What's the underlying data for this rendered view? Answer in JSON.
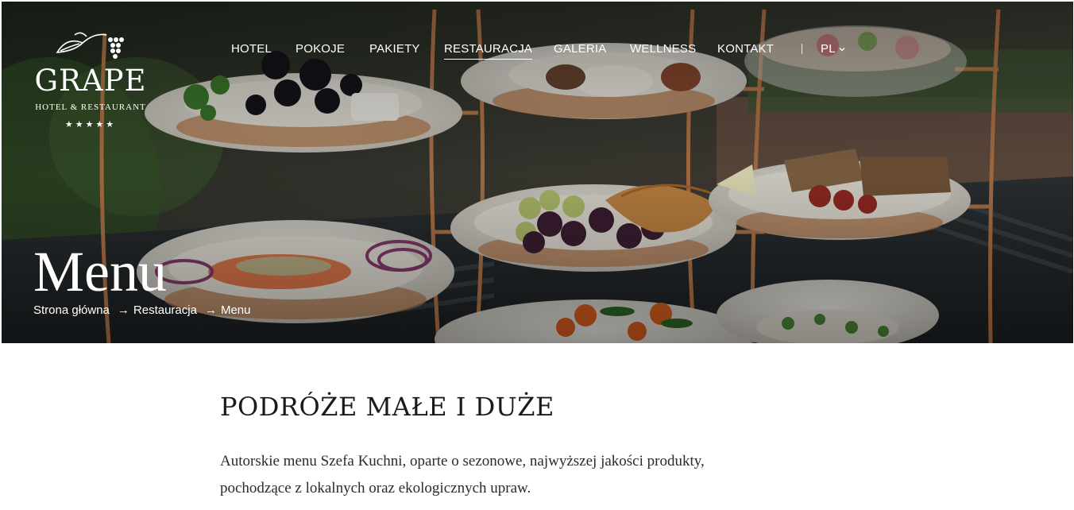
{
  "logo": {
    "word": "GRAPE",
    "subtitle": "HOTEL & RESTAURANT",
    "stars": "★★★★★"
  },
  "nav": {
    "items": [
      {
        "label": "HOTEL"
      },
      {
        "label": "POKOJE"
      },
      {
        "label": "PAKIETY"
      },
      {
        "label": "RESTAURACJA",
        "active": true
      },
      {
        "label": "GALERIA"
      },
      {
        "label": "WELLNESS"
      },
      {
        "label": "KONTAKT"
      }
    ],
    "language": "PL",
    "language_icon": "chevron-down-icon"
  },
  "hero": {
    "title": "Menu",
    "breadcrumb": {
      "home": "Strona główna",
      "section": "Restauracja",
      "current": "Menu",
      "separator": "→"
    }
  },
  "content": {
    "heading": "PODRÓŻE MAŁE I DUŻE",
    "paragraph_line1": "Autorskie menu Szefa Kuchni, oparte o sezonowe, najwyższej jakości produkty,",
    "paragraph_line2": "pochodzące z lokalnych oraz ekologicznych upraw."
  },
  "colors": {
    "hero_overlay": "#2a2b27",
    "text_dark": "#1a1a1a",
    "accent_copper": "#b8794a"
  }
}
